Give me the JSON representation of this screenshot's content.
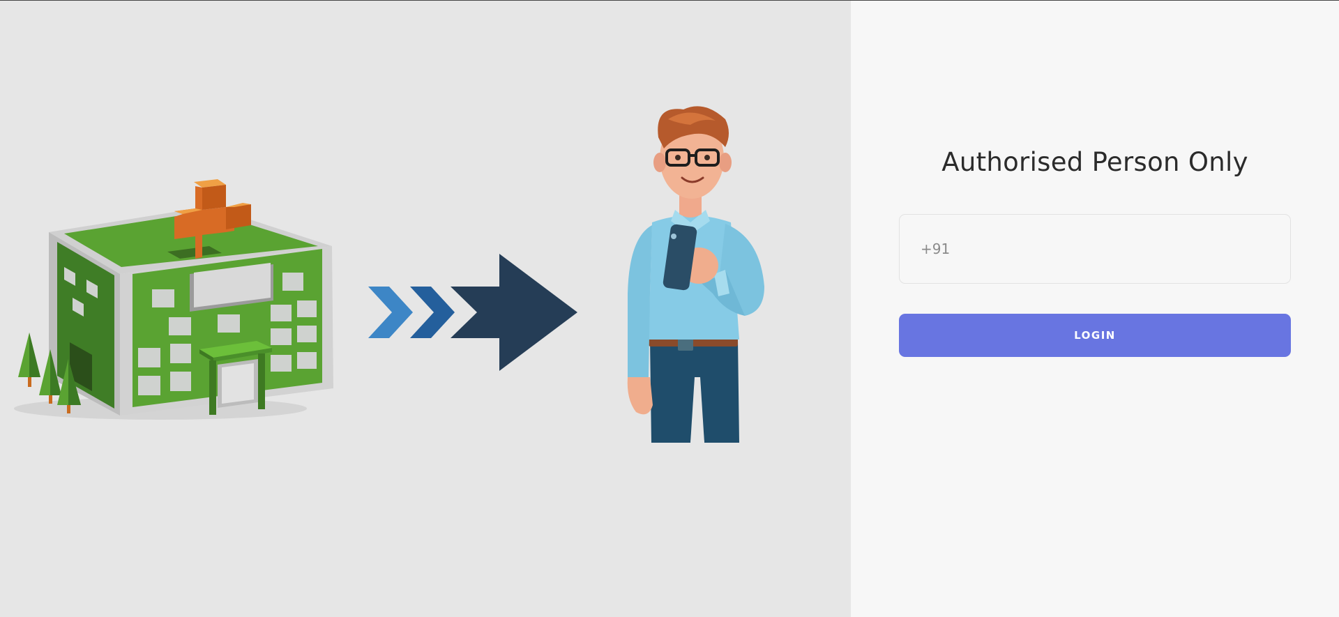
{
  "login": {
    "title": "Authorised Person Only",
    "phone_placeholder": "+91",
    "phone_value": "",
    "login_label": "LOGIN"
  },
  "illustration": {
    "hospital": "hospital-building-icon",
    "arrow": "right-arrow-icon",
    "person": "person-with-phone-icon"
  },
  "colors": {
    "left_bg": "#e6e6e6",
    "right_bg": "#f7f7f7",
    "button": "#6875e1",
    "arrow_light": "#3d86c6",
    "arrow_mid": "#245f9c",
    "arrow_dark": "#253d56",
    "hospital_green": "#5aa332",
    "hospital_cross": "#d86b25"
  }
}
